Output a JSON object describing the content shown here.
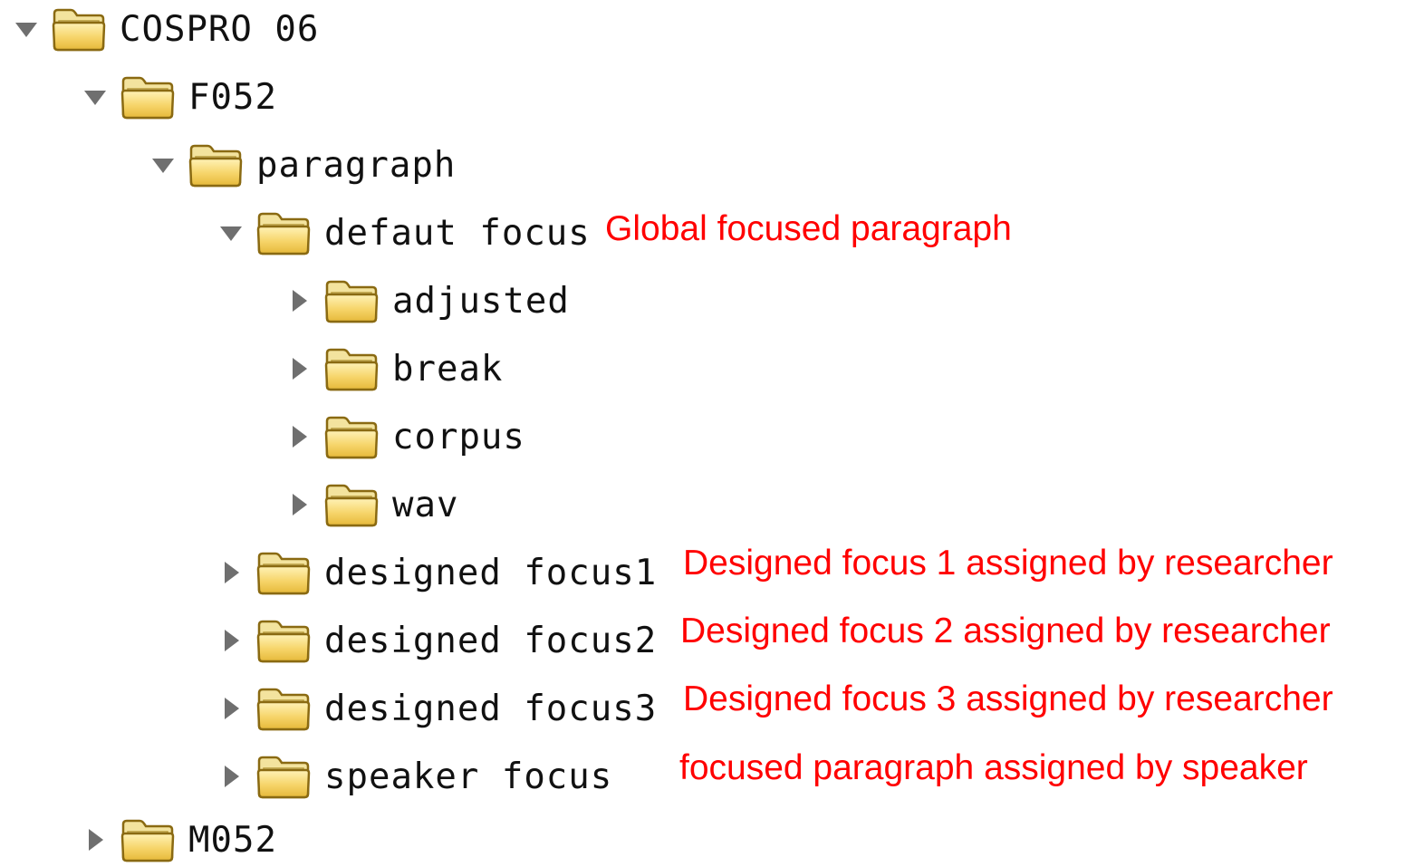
{
  "colors": {
    "annotation": "#ff0000",
    "folder_fill": "#f6d469",
    "folder_edge": "#8a6a12",
    "toggle": "#6f6f6f",
    "label": "#111111"
  },
  "tree": {
    "root": {
      "label": "COSPRO 06",
      "state": "expanded",
      "icon": "folder-icon"
    },
    "f052": {
      "label": "F052",
      "state": "expanded",
      "icon": "folder-icon"
    },
    "paragraph": {
      "label": "paragraph",
      "state": "expanded",
      "icon": "folder-icon"
    },
    "default_focus": {
      "label": "defaut focus",
      "state": "expanded",
      "icon": "folder-icon"
    },
    "adjusted": {
      "label": "adjusted",
      "state": "collapsed",
      "icon": "folder-icon"
    },
    "break": {
      "label": "break",
      "state": "collapsed",
      "icon": "folder-icon"
    },
    "corpus": {
      "label": "corpus",
      "state": "collapsed",
      "icon": "folder-icon"
    },
    "wav": {
      "label": "wav",
      "state": "collapsed",
      "icon": "folder-icon"
    },
    "designed_focus1": {
      "label": "designed focus1",
      "state": "collapsed",
      "icon": "folder-icon"
    },
    "designed_focus2": {
      "label": "designed focus2",
      "state": "collapsed",
      "icon": "folder-icon"
    },
    "designed_focus3": {
      "label": "designed focus3",
      "state": "collapsed",
      "icon": "folder-icon"
    },
    "speaker_focus": {
      "label": "speaker focus",
      "state": "collapsed",
      "icon": "folder-icon"
    },
    "m052": {
      "label": "M052",
      "state": "collapsed",
      "icon": "folder-icon"
    }
  },
  "annotations": {
    "default_focus": "Global focused paragraph",
    "designed_focus1": "Designed focus 1 assigned by researcher",
    "designed_focus2": "Designed focus 2 assigned by researcher",
    "designed_focus3": "Designed focus 3 assigned by researcher",
    "speaker_focus": "focused paragraph assigned by speaker"
  }
}
